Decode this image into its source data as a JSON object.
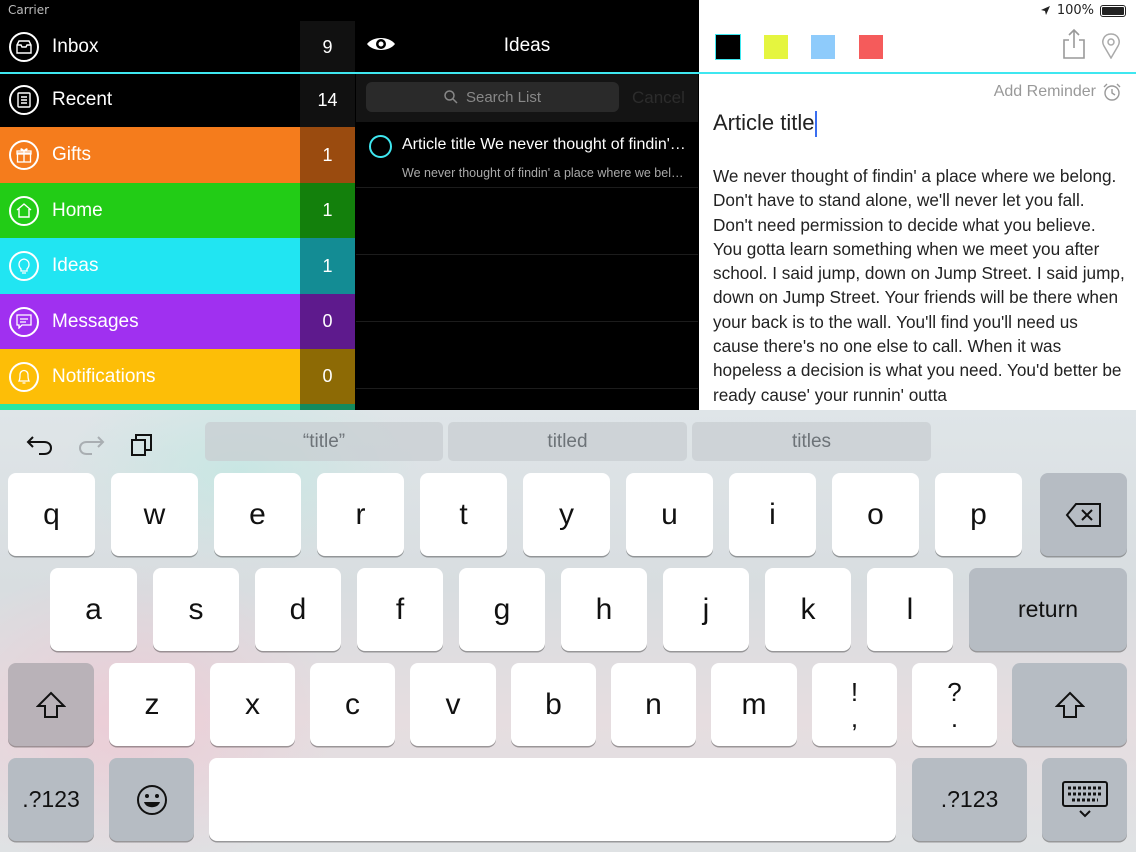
{
  "status_bar": {
    "carrier": "Carrier",
    "battery": "100%"
  },
  "sidebar": {
    "items": [
      {
        "label": "Inbox",
        "count": "9",
        "color": "#000000",
        "count_color": "#111111",
        "icon": "inbox-icon"
      },
      {
        "label": "Recent",
        "count": "14",
        "color": "#000000",
        "count_color": "#111111",
        "icon": "recent-icon"
      },
      {
        "label": "Gifts",
        "count": "1",
        "color": "#f57c1c",
        "count_color": "#9a4b0f",
        "icon": "gift-icon"
      },
      {
        "label": "Home",
        "count": "1",
        "color": "#22cc16",
        "count_color": "#13800c",
        "icon": "home-icon"
      },
      {
        "label": "Ideas",
        "count": "1",
        "color": "#21e5f2",
        "count_color": "#138c94",
        "icon": "lightbulb-icon"
      },
      {
        "label": "Messages",
        "count": "0",
        "color": "#a030f0",
        "count_color": "#5e1a8d",
        "icon": "message-icon"
      },
      {
        "label": "Notifications",
        "count": "0",
        "color": "#fdbe07",
        "count_color": "#8d6a05",
        "icon": "bell-icon"
      }
    ],
    "next_item_color": "#27e8a0"
  },
  "list": {
    "title": "Ideas",
    "search_placeholder": "Search List",
    "cancel_label": "Cancel",
    "notes": [
      {
        "title": "Article title We never thought of findin' a place where we belong.",
        "snippet": "We never thought of findin' a place where we belong. Don't have to stand alone"
      }
    ],
    "accent_color": "#3fe7f0"
  },
  "editor": {
    "swatches": [
      "#000000",
      "#e5f53f",
      "#8ecbfb",
      "#f55b5b"
    ],
    "add_reminder_label": "Add Reminder",
    "title": "Article title",
    "body": "We never thought of findin' a place where we belong. Don't have to stand alone, we'll never let you fall. Don't need permission to decide what you believe. You gotta learn something when we meet you after school. I said jump, down on Jump Street. I said jump, down on Jump Street. Your friends will be there when your back is to the wall. You'll find you'll need us cause there's no one else to call. When it was hopeless a decision is what you need. You'd better be ready cause' your runnin' outta"
  },
  "keyboard": {
    "suggestions": [
      "“title”",
      "titled",
      "titles"
    ],
    "row1": [
      "q",
      "w",
      "e",
      "r",
      "t",
      "y",
      "u",
      "i",
      "o",
      "p"
    ],
    "row2": [
      "a",
      "s",
      "d",
      "f",
      "g",
      "h",
      "j",
      "k",
      "l"
    ],
    "row3": [
      "z",
      "x",
      "c",
      "v",
      "b",
      "n",
      "m"
    ],
    "return_label": "return",
    "numbers_label": ".?123",
    "punct1": [
      "!",
      ","
    ],
    "punct2": [
      "?",
      "."
    ]
  }
}
